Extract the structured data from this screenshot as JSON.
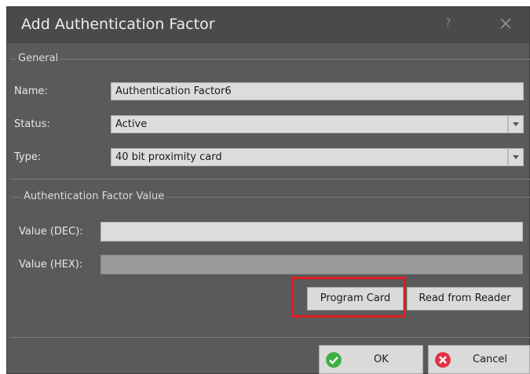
{
  "dialog": {
    "title": "Add Authentication Factor",
    "help_glyph": "?",
    "close_glyph": "✕"
  },
  "general": {
    "group_label": "General",
    "name_label": "Name:",
    "name_value": "Authentication Factor6",
    "status_label": "Status:",
    "status_value": "Active",
    "type_label": "Type:",
    "type_value": "40 bit proximity card"
  },
  "factor_value": {
    "group_label": "Authentication Factor Value",
    "dec_label": "Value (DEC):",
    "dec_value": "",
    "hex_label": "Value (HEX):",
    "hex_value": "",
    "program_card_label": "Program Card",
    "read_reader_label": "Read from Reader"
  },
  "footer": {
    "ok_label": "OK",
    "cancel_label": "Cancel"
  },
  "colors": {
    "highlight": "#e11b22",
    "ok_icon": "#3cb043",
    "cancel_icon": "#e0334a"
  },
  "icons": {
    "ok": "check-circle-icon",
    "cancel": "x-circle-icon",
    "dropdown": "chevron-down-icon"
  }
}
